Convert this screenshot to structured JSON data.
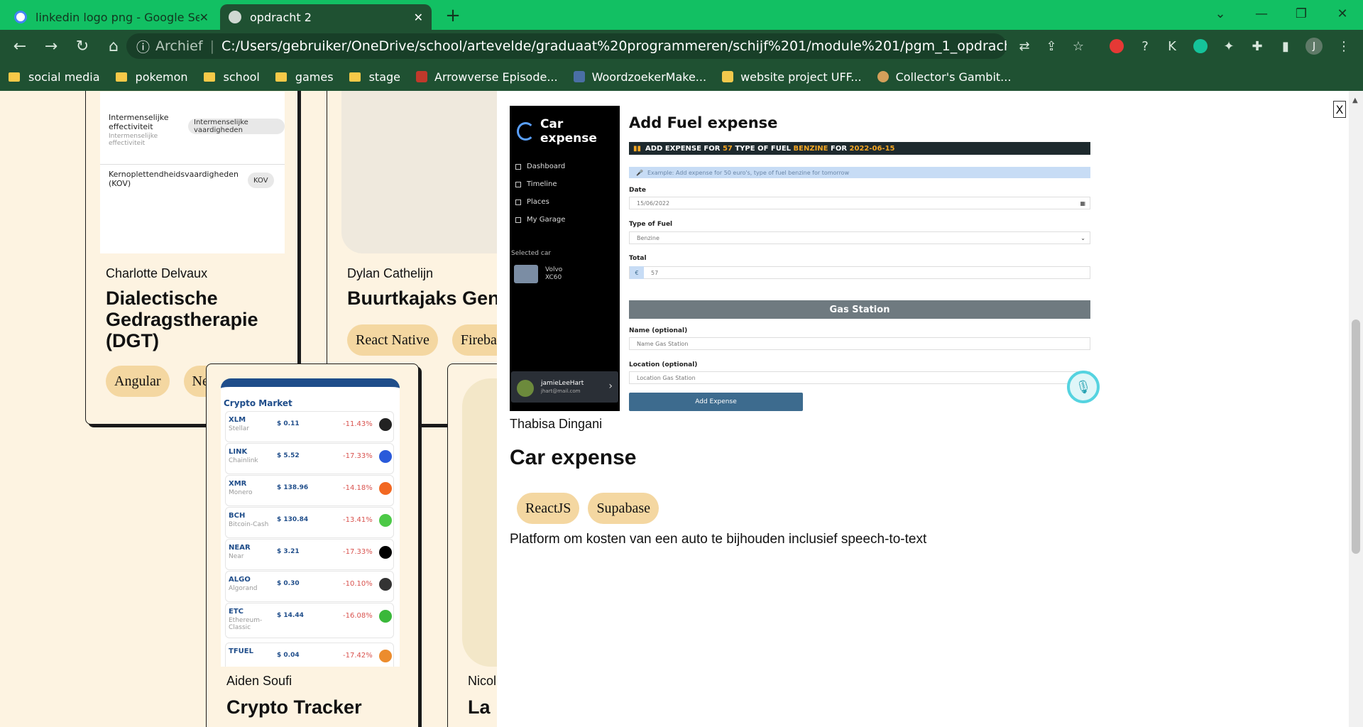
{
  "browser": {
    "tabs": [
      {
        "label": "linkedin logo png - Google Search"
      },
      {
        "label": "opdracht 2"
      }
    ],
    "address": {
      "security_label": "Archief",
      "url": "C:/Users/gebruiker/OneDrive/school/artevelde/graduaat%20programmeren/schijf%201/module%201/pgm_1_opdracht_2_DeGoote_Jonas/app/i..."
    },
    "bookmarks": [
      {
        "label": "social media"
      },
      {
        "label": "pokemon"
      },
      {
        "label": "school"
      },
      {
        "label": "games"
      },
      {
        "label": "stage"
      },
      {
        "label": "Arrowverse Episode..."
      },
      {
        "label": "WoordzoekerMake..."
      },
      {
        "label": "website project UFF..."
      },
      {
        "label": "Collector's Gambit..."
      }
    ],
    "profile_initial": "J"
  },
  "cards": {
    "card1": {
      "skills": [
        {
          "name": "Intermenselijke effectiviteit",
          "sub": "Intermenselijke effectiviteit",
          "tag": "Intermenselijke vaardigheden"
        },
        {
          "name": "Kernoplettendheidsvaardigheden (KOV)",
          "sub": "",
          "tag": "KOV"
        }
      ],
      "student": "Charlotte Delvaux",
      "title": "Dialectische Gedragstherapie (DGT)",
      "tags": [
        "Angular",
        "NestJS"
      ]
    },
    "card2": {
      "student": "Dylan Cathelijn",
      "title": "Buurtkajaks Gent",
      "tags": [
        "React Native",
        "Firebase"
      ]
    },
    "card3": {
      "student": "Aiden Soufi",
      "title": "Crypto Tracker",
      "crypto": {
        "header": "Crypto Market",
        "rows": [
          {
            "sym": "XLM",
            "name": "Stellar",
            "price": "$ 0.11",
            "change": "-11.43%"
          },
          {
            "sym": "LINK",
            "name": "Chainlink",
            "price": "$ 5.52",
            "change": "-17.33%"
          },
          {
            "sym": "XMR",
            "name": "Monero",
            "price": "$ 138.96",
            "change": "-14.18%"
          },
          {
            "sym": "BCH",
            "name": "Bitcoin-Cash",
            "price": "$ 130.84",
            "change": "-13.41%"
          },
          {
            "sym": "NEAR",
            "name": "Near",
            "price": "$ 3.21",
            "change": "-17.33%"
          },
          {
            "sym": "ALGO",
            "name": "Algorand",
            "price": "$ 0.30",
            "change": "-10.10%"
          },
          {
            "sym": "ETC",
            "name": "Ethereum-Classic",
            "price": "$ 14.44",
            "change": "-16.08%"
          },
          {
            "sym": "TFUEL",
            "name": "",
            "price": "$ 0.04",
            "change": "-17.42%"
          }
        ]
      }
    },
    "card4": {
      "student": "Nicol",
      "title": "La"
    }
  },
  "modal": {
    "close_label": "X",
    "screenshot": {
      "brand": "Car expense",
      "nav": [
        "Dashboard",
        "Timeline",
        "Places",
        "My Garage"
      ],
      "selected_car_label": "Selected car",
      "car_name": "Volvo XC60",
      "user_name": "jamieLeeHart",
      "user_email": "jhart@mail.com",
      "heading": "Add Fuel expense",
      "banner_prefix": "ADD EXPENSE FOR",
      "banner_amount": "57",
      "banner_mid": "TYPE OF FUEL",
      "banner_fuel": "BENZINE",
      "banner_for": "FOR",
      "banner_date": "2022-06-15",
      "hint": "Example: Add expense for 50 euro's, type of fuel benzine for tomorrow",
      "date_label": "Date",
      "date_value": "15/06/2022",
      "fuel_label": "Type of Fuel",
      "fuel_value": "Benzine",
      "total_label": "Total",
      "currency": "€",
      "total_value": "57",
      "gas_station_heading": "Gas Station",
      "name_label": "Name (optional)",
      "name_placeholder": "Name Gas Station",
      "location_label": "Location (optional)",
      "location_placeholder": "Location Gas Station",
      "submit_label": "Add Expense"
    },
    "student": "Thabisa Dingani",
    "title": "Car expense",
    "tags": [
      "ReactJS",
      "Supabase"
    ],
    "description": "Platform om kosten van een auto te bijhouden inclusief speech-to-text"
  },
  "colors": {
    "tabbar": "#12c063",
    "toolbar": "#1f5132",
    "page_bg": "#fdf3e1",
    "pill": "#f4d7a1"
  }
}
